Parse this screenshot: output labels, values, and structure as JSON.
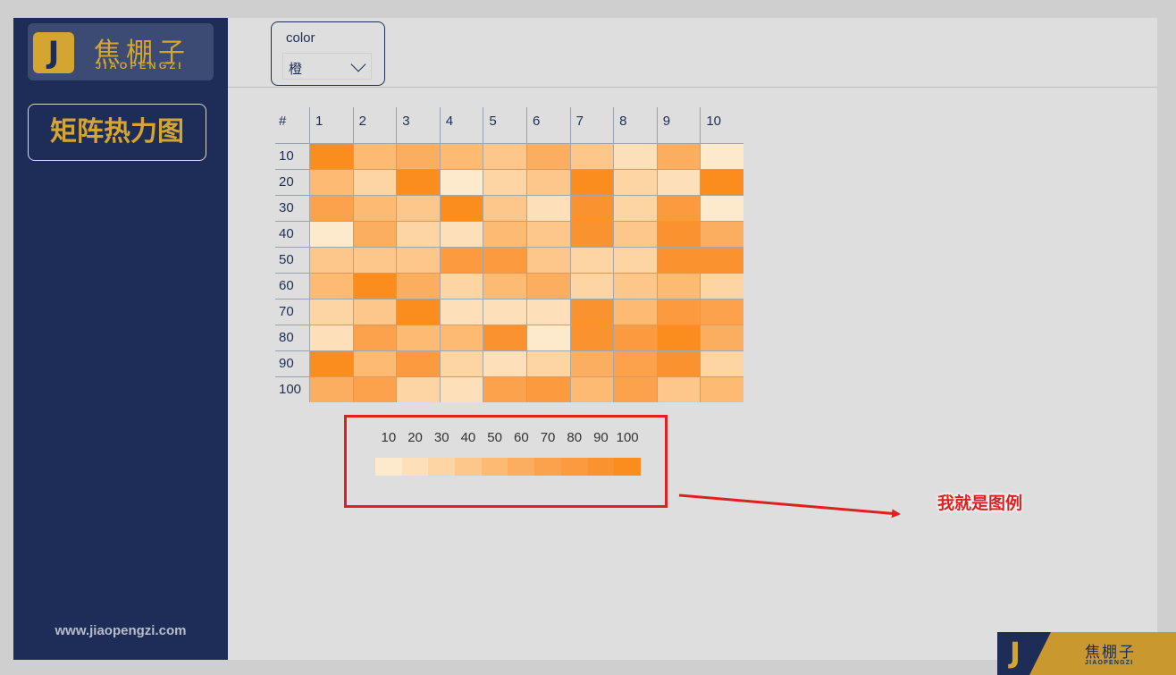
{
  "sidebar": {
    "logo_letter": "J",
    "brand_cn": "焦棚子",
    "brand_en": "JIAOPENGZI",
    "title": "矩阵热力图",
    "site_url": "www.jiaopengzi.com"
  },
  "filter": {
    "label": "color",
    "selected": "橙"
  },
  "heatmap": {
    "corner": "#",
    "columns": [
      "1",
      "2",
      "3",
      "4",
      "5",
      "6",
      "7",
      "8",
      "9",
      "10"
    ],
    "rows": [
      {
        "label": "10",
        "levels": [
          10,
          5,
          6,
          5,
          4,
          6,
          4,
          2,
          6,
          1
        ]
      },
      {
        "label": "20",
        "levels": [
          5,
          3,
          10,
          1,
          3,
          4,
          10,
          3,
          2,
          10
        ]
      },
      {
        "label": "30",
        "levels": [
          7,
          5,
          4,
          10,
          4,
          2,
          9,
          3,
          8,
          1
        ]
      },
      {
        "label": "40",
        "levels": [
          1,
          6,
          3,
          2,
          5,
          4,
          9,
          4,
          9,
          6
        ]
      },
      {
        "label": "50",
        "levels": [
          4,
          4,
          4,
          8,
          8,
          4,
          3,
          3,
          9,
          9
        ]
      },
      {
        "label": "60",
        "levels": [
          5,
          10,
          6,
          3,
          5,
          6,
          3,
          4,
          5,
          3
        ]
      },
      {
        "label": "70",
        "levels": [
          3,
          4,
          10,
          2,
          2,
          2,
          9,
          5,
          8,
          7
        ]
      },
      {
        "label": "80",
        "levels": [
          2,
          7,
          5,
          5,
          9,
          1,
          9,
          8,
          10,
          6
        ]
      },
      {
        "label": "90",
        "levels": [
          10,
          5,
          8,
          3,
          2,
          3,
          6,
          7,
          9,
          3
        ]
      },
      {
        "label": "100",
        "levels": [
          6,
          7,
          3,
          2,
          7,
          8,
          5,
          7,
          4,
          5
        ]
      }
    ]
  },
  "legend": {
    "labels": [
      "10",
      "20",
      "30",
      "40",
      "50",
      "60",
      "70",
      "80",
      "90",
      "100"
    ],
    "colors": [
      "#fde9cc",
      "#fde0b9",
      "#fdd5a3",
      "#fdc68a",
      "#fdba73",
      "#fcae60",
      "#fca24c",
      "#fb9a3e",
      "#fb9230",
      "#fb8c1e"
    ]
  },
  "annotation": {
    "text": "我就是图例",
    "color": "#e02020"
  },
  "watermark": {
    "letter": "J",
    "brand_cn": "焦棚子",
    "brand_en": "JIAOPENGZI"
  }
}
